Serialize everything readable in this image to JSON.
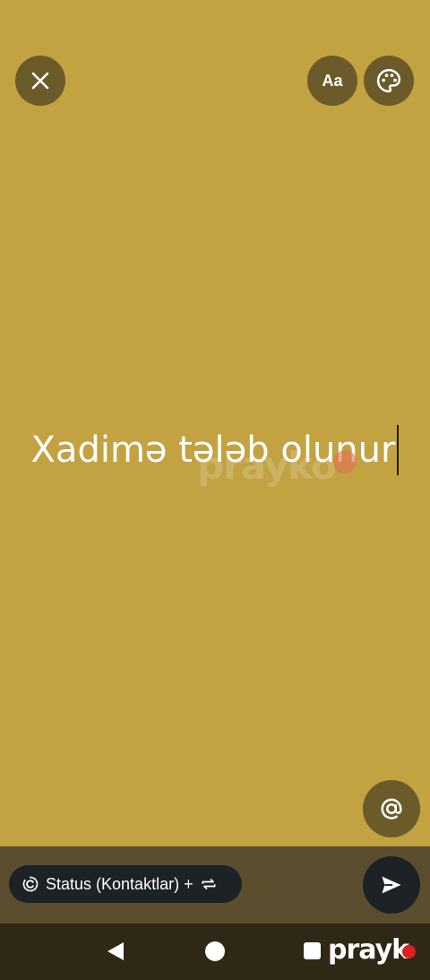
{
  "composer": {
    "background_color": "#c3a242",
    "status_text": "Xadimə tələb olunur",
    "font_button_label": "Aa",
    "watermark": "prayko"
  },
  "icons": {
    "close": "close-icon",
    "font": "font-style-icon",
    "palette": "palette-icon",
    "mention": "at-sign-icon",
    "send": "send-icon",
    "audience": "status-audience-icon",
    "swap": "swap-icon"
  },
  "footer": {
    "audience_label": "Status (Kontaktlar) +",
    "bar_color": "#5b4e2f"
  },
  "nav": {
    "brand": "prayk",
    "brand_dot_color": "#e02020"
  }
}
